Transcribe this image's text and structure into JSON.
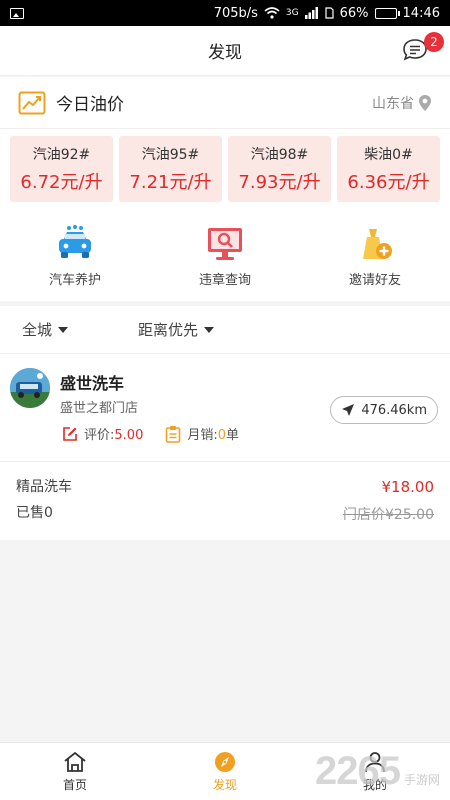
{
  "status_bar": {
    "speed": "705b/s",
    "network": "3G",
    "battery": "66%",
    "time": "14:46"
  },
  "header": {
    "title": "发现",
    "badge_count": "2"
  },
  "oil_price": {
    "label": "今日油价",
    "location": "山东省"
  },
  "oil_cards": [
    {
      "name": "汽油92#",
      "price": "6.72元/升"
    },
    {
      "name": "汽油95#",
      "price": "7.21元/升"
    },
    {
      "name": "汽油98#",
      "price": "7.93元/升"
    },
    {
      "name": "柴油0#",
      "price": "6.36元/升"
    }
  ],
  "services": [
    {
      "label": "汽车养护",
      "icon": "car-wash-icon"
    },
    {
      "label": "违章查询",
      "icon": "monitor-search-icon"
    },
    {
      "label": "邀请好友",
      "icon": "invite-friend-icon"
    }
  ],
  "filters": {
    "area": "全城",
    "sort": "距离优先"
  },
  "shop": {
    "name": "盛世洗车",
    "address": "盛世之都门店",
    "distance": "476.46km",
    "rating_label": "评价:",
    "rating_value": "5.00",
    "sales_label": "月销:",
    "sales_value": "0",
    "sales_unit": "单"
  },
  "product": {
    "name": "精品洗车",
    "sold": "已售0",
    "price": "¥18.00",
    "original_price": "门店价¥25.00"
  },
  "tabbar": [
    {
      "label": "首页",
      "icon": "home-icon"
    },
    {
      "label": "发现",
      "icon": "compass-icon"
    },
    {
      "label": "我的",
      "icon": "user-icon"
    }
  ],
  "watermark": {
    "number": "2265",
    "site": "手游网"
  },
  "colors": {
    "accent": "#f0a020",
    "price_red": "#e02a2a",
    "card_bg": "#fbe7e4",
    "badge": "#e8303a"
  }
}
